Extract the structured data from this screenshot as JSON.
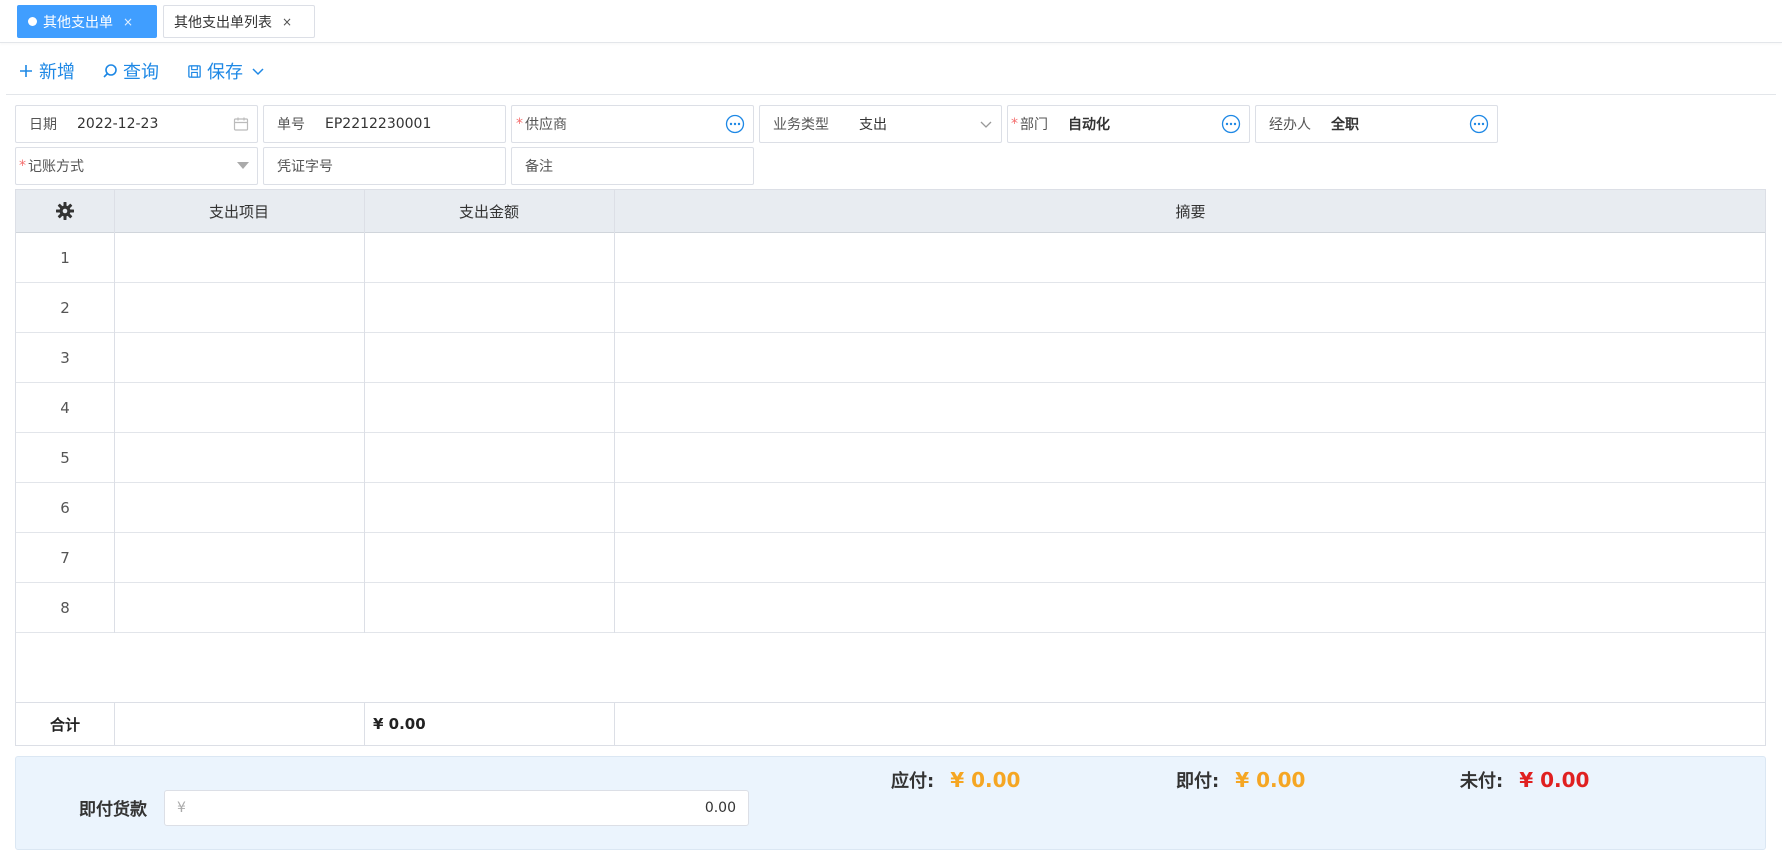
{
  "tabs": [
    {
      "label": "其他支出单",
      "close": "×"
    },
    {
      "label": "其他支出单列表",
      "close": "×"
    }
  ],
  "toolbar": {
    "add_label": "新增",
    "query_label": "查询",
    "save_label": "保存"
  },
  "form": {
    "date_label": "日期",
    "date_value": "2022-12-23",
    "number_label": "单号",
    "number_value": "EP2212230001",
    "supplier_label": "供应商",
    "biztype_label": "业务类型",
    "biztype_value": "支出",
    "dept_label": "部门",
    "dept_value": "自动化",
    "handler_label": "经办人",
    "handler_value": "全职",
    "account_method_label": "记账方式",
    "voucher_label": "凭证字号",
    "remark_label": "备注",
    "required_mark": "*"
  },
  "table": {
    "columns": [
      "支出项目",
      "支出金额",
      "摘要"
    ],
    "row_numbers": [
      "1",
      "2",
      "3",
      "4",
      "5",
      "6",
      "7",
      "8"
    ],
    "total_label": "合计",
    "total_amount": "¥ 0.00"
  },
  "payment": {
    "label": "即付货款",
    "currency": "¥",
    "amount": "0.00",
    "payable_label": "应付:",
    "payable_value": "¥ 0.00",
    "paid_label": "即付:",
    "paid_value": "¥ 0.00",
    "unpaid_label": "未付:",
    "unpaid_value": "¥ 0.00"
  },
  "colors": {
    "primary": "#409eff",
    "link": "#1e88e5",
    "orange": "#f5a623",
    "red": "#e02020",
    "required": "#f56c6c"
  }
}
